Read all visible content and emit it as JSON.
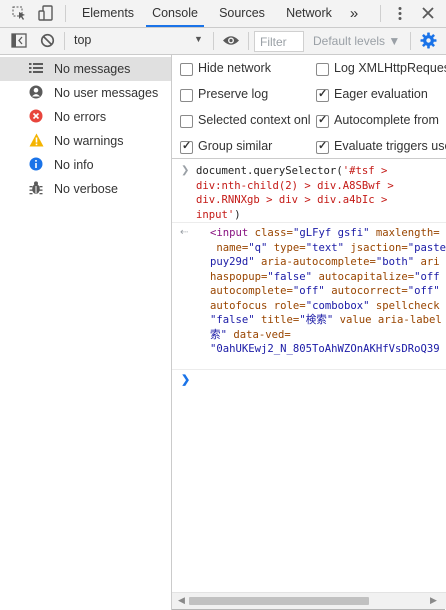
{
  "tabs": [
    "Elements",
    "Console",
    "Sources",
    "Network"
  ],
  "tab_overflow": "»",
  "toolbar": {
    "context": "top",
    "filter_placeholder": "Filter",
    "levels": "Default levels ▼"
  },
  "sidebar": [
    {
      "label": "No messages",
      "icon": "list-icon"
    },
    {
      "label": "No user messages",
      "icon": "user-icon"
    },
    {
      "label": "No errors",
      "icon": "error-icon"
    },
    {
      "label": "No warnings",
      "icon": "warning-icon"
    },
    {
      "label": "No info",
      "icon": "info-icon"
    },
    {
      "label": "No verbose",
      "icon": "bug-icon"
    }
  ],
  "settings": {
    "hide_network": "Hide network",
    "preserve_log": "Preserve log",
    "selected_context": "Selected context onl",
    "group_similar": "Group similar",
    "log_xml": "Log XMLHttpReques",
    "eager_eval": "Eager evaluation",
    "autocomplete": "Autocomplete from",
    "evaluate_triggers": "Evaluate triggers use"
  },
  "console": {
    "cmd_line1_a": "document.querySelector(",
    "cmd_line1_b": "'#tsf >",
    "cmd_line2": "div:nth-child(2) > div.A8SBwf >",
    "cmd_line3": "div.RNNXgb > div > div.a4bIc >",
    "cmd_line4_a": "input'",
    "cmd_line4_b": ")",
    "out": {
      "l1_tag": "<input",
      "l1_attr": " class=",
      "l1_val": "\"gLFyf gsfi\"",
      "l1_attr2": " maxlength=",
      "l2_attr": " name=",
      "l2_val": "\"q\"",
      "l2_attr2": " type=",
      "l2_val2": "\"text\"",
      "l2_attr3": " jsaction=",
      "l2_val3": "\"paste",
      "l3_val": "puy29d\"",
      "l3_attr": " aria-autocomplete=",
      "l3_val2": "\"both\"",
      "l3_attr2": " ari",
      "l4_attr": "haspopup=",
      "l4_val": "\"false\"",
      "l4_attr2": " autocapitalize=",
      "l4_val2": "\"off",
      "l5_attr": "autocomplete=",
      "l5_val": "\"off\"",
      "l5_attr2": " autocorrect=",
      "l5_val2": "\"off\"",
      "l6_attr": "autofocus",
      "l6_attr2": " role=",
      "l6_val": "\"combobox\"",
      "l6_attr3": " spellcheck",
      "l7_val": "\"false\"",
      "l7_attr": " title=",
      "l7_val2": "\"検索\"",
      "l7_attr2": " value",
      "l7_attr3": " aria-label",
      "l8_val": "索\"",
      "l8_attr": " data-ved=",
      "l9_val": "\"0ahUKEwj2_N_805ToAhWZOnAKHfVsDRoQ39"
    }
  },
  "colors": {
    "accent": "#1a73e8",
    "error": "#e8453c",
    "warning": "#f4b400",
    "info": "#1a73e8"
  }
}
